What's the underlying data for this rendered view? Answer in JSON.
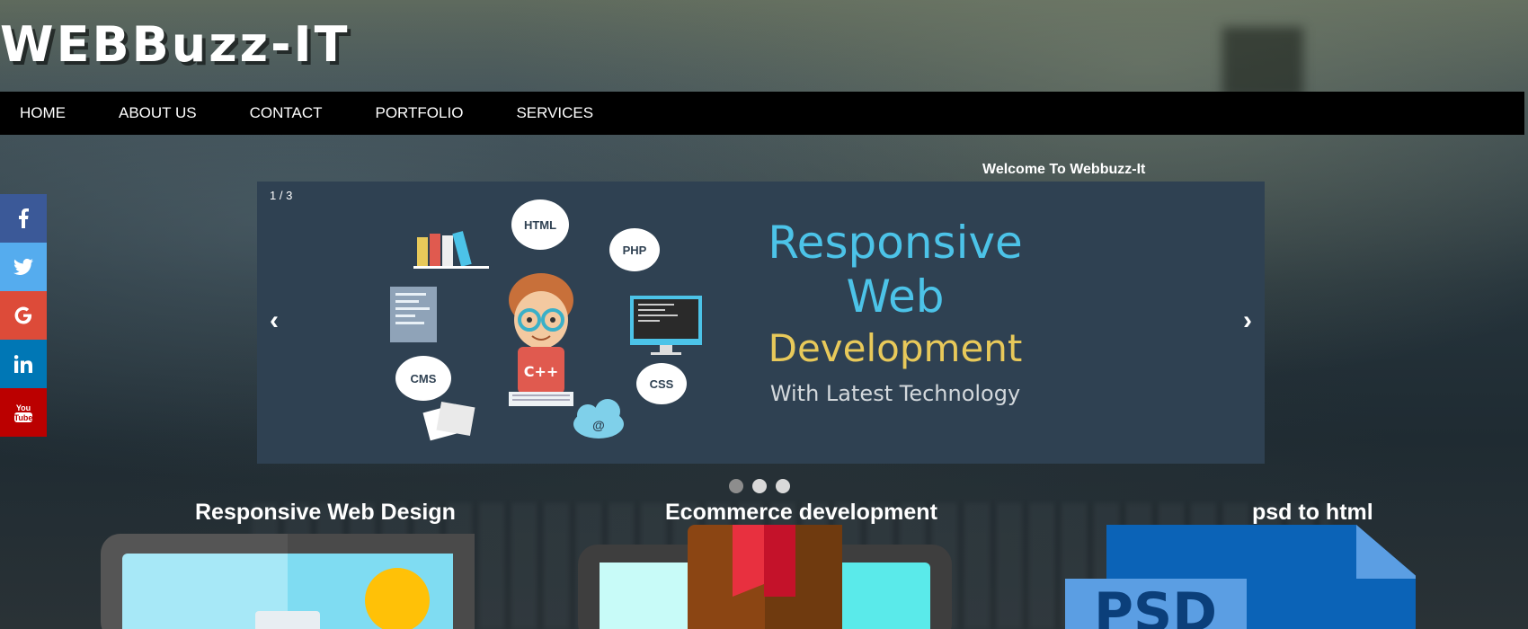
{
  "site": {
    "logo": "WEBBuzz-IT"
  },
  "nav": {
    "items": [
      {
        "label": "HOME"
      },
      {
        "label": "ABOUT US"
      },
      {
        "label": "CONTACT"
      },
      {
        "label": "PORTFOLIO"
      },
      {
        "label": "SERVICES"
      }
    ]
  },
  "welcome": "Welcome To Webbuzz-It",
  "social": [
    {
      "name": "facebook-icon",
      "glyph": "f",
      "color": "#3b5998"
    },
    {
      "name": "twitter-icon",
      "glyph": "🐦",
      "color": "#55acee"
    },
    {
      "name": "google-icon",
      "glyph": "G",
      "color": "#dd4b39"
    },
    {
      "name": "linkedin-icon",
      "glyph": "in",
      "color": "#0077b5"
    },
    {
      "name": "youtube-icon",
      "glyph": "You Tube",
      "color": "#bb0000"
    }
  ],
  "slider": {
    "counter": "1 / 3",
    "prev": "‹",
    "next": "›",
    "slide": {
      "line1": "Responsive",
      "line2": "Web",
      "line3": "Development",
      "line4": "With Latest Technology",
      "bubbles": [
        "HTML",
        "PHP",
        "CMS",
        "CSS",
        "@"
      ],
      "shirt": "C++"
    },
    "total_slides": 3,
    "active_slide": 1
  },
  "services": [
    {
      "title": "Responsive Web Design"
    },
    {
      "title": "Ecommerce development"
    },
    {
      "title": "psd to html",
      "badge": "PSD"
    }
  ],
  "colors": {
    "nav_bg": "#000000",
    "slide_bg": "#2f4152",
    "accent_blue": "#4cc3e8",
    "accent_yellow": "#e8c95a"
  }
}
